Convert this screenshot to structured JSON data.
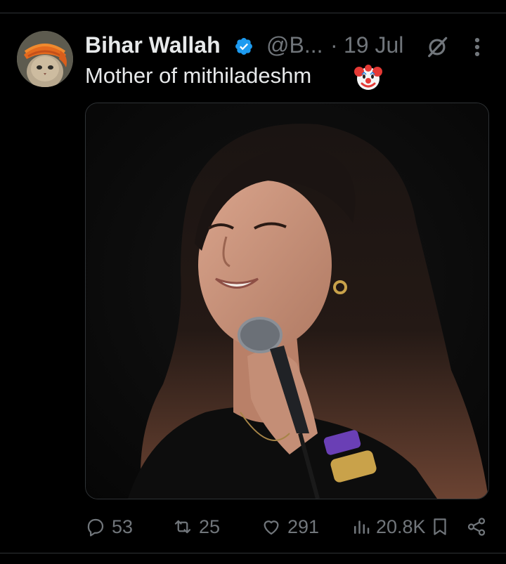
{
  "tweet": {
    "author_name": "Bihar Wallah",
    "handle": "@B...",
    "separator": "·",
    "time": "19 Jul",
    "text": "Mother of mithiladeshm",
    "emoji": "clown-face"
  },
  "actions": {
    "replies": "53",
    "reposts": "25",
    "likes": "291",
    "views": "20.8K"
  },
  "icons": {
    "verified": "verified-badge-icon",
    "grok": "grok-icon",
    "more": "more-icon",
    "reply": "reply-icon",
    "repost": "repost-icon",
    "like": "heart-icon",
    "views": "analytics-icon",
    "bookmark": "bookmark-icon",
    "share": "share-icon"
  },
  "colors": {
    "background": "#000000",
    "text": "#e7e9ea",
    "muted": "#71767b",
    "verified": "#1d9bf0",
    "divider": "#2f3336"
  }
}
